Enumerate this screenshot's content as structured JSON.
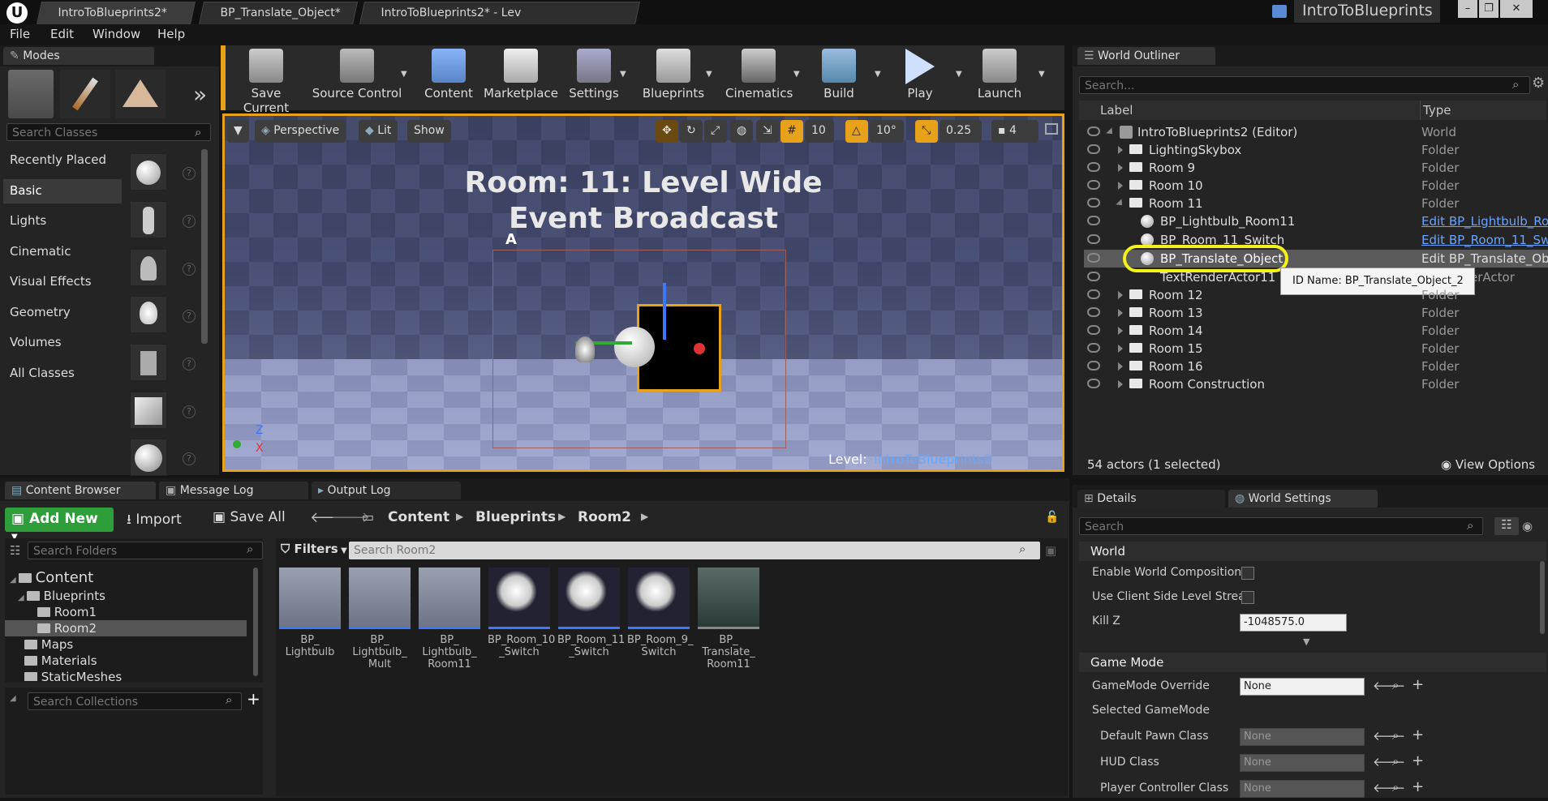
{
  "app": {
    "logo": "U"
  },
  "tabs": [
    "IntroToBlueprints2*",
    "BP_Translate_Object*",
    "IntroToBlueprints2* - Lev"
  ],
  "project_name": "IntroToBlueprints",
  "menu": [
    "File",
    "Edit",
    "Window",
    "Help"
  ],
  "modes": {
    "tab": "Modes",
    "search_placeholder": "Search Classes",
    "categories": [
      "Recently Placed",
      "Basic",
      "Lights",
      "Cinematic",
      "Visual Effects",
      "Geometry",
      "Volumes",
      "All Classes"
    ],
    "selected": "Basic"
  },
  "toolbar": {
    "save_current": "Save Current",
    "source_control": "Source Control",
    "content": "Content",
    "marketplace": "Marketplace",
    "settings": "Settings",
    "blueprints": "Blueprints",
    "cinematics": "Cinematics",
    "build": "Build",
    "play": "Play",
    "launch": "Launch"
  },
  "viewport": {
    "perspective": "Perspective",
    "lit": "Lit",
    "show": "Show",
    "grid_snap": "10",
    "rot_snap": "10°",
    "scale_snap": "0.25",
    "cam_speed": "4",
    "room_title_line1": "Room: 11: Level Wide",
    "room_title_line2": "Event Broadcast",
    "marker_a": "A",
    "axis_z": "Z",
    "axis_x": "X",
    "level_label": "Level:",
    "level_name": "IntroToBlueprints2 (Persistent)"
  },
  "outliner": {
    "tab": "World Outliner",
    "search_placeholder": "Search...",
    "col_label": "Label",
    "col_type": "Type",
    "rows": [
      {
        "label": "IntroToBlueprints2 (Editor)",
        "type": "World"
      },
      {
        "label": "LightingSkybox",
        "type": "Folder"
      },
      {
        "label": "Room 9",
        "type": "Folder"
      },
      {
        "label": "Room 10",
        "type": "Folder"
      },
      {
        "label": "Room 11",
        "type": "Folder"
      },
      {
        "label": "BP_Lightbulb_Room11",
        "type": "Edit BP_Lightbulb_Roo"
      },
      {
        "label": "BP_Room_11_Switch",
        "type": "Edit BP_Room_11_Sw"
      },
      {
        "label": "BP_Translate_Object",
        "type": "Edit BP_Translate_Ob"
      },
      {
        "label": "TextRenderActor11",
        "type": "erActor"
      },
      {
        "label": "Room 12",
        "type": "Folder"
      },
      {
        "label": "Room 13",
        "type": "Folder"
      },
      {
        "label": "Room 14",
        "type": "Folder"
      },
      {
        "label": "Room 15",
        "type": "Folder"
      },
      {
        "label": "Room 16",
        "type": "Folder"
      },
      {
        "label": "Room Construction",
        "type": "Folder"
      }
    ],
    "tooltip": "ID Name: BP_Translate_Object_2",
    "actor_count": "54 actors (1 selected)",
    "view_options": "View Options"
  },
  "details": {
    "tab_details": "Details",
    "tab_world_settings": "World Settings",
    "search_placeholder": "Search",
    "section_world": "World",
    "enable_world_composition": "Enable World Composition",
    "use_client_side": "Use Client Side Level Strea",
    "kill_z_label": "Kill Z",
    "kill_z_value": "-1048575.0",
    "section_game_mode": "Game Mode",
    "gamemode_override": "GameMode Override",
    "gamemode_override_value": "None",
    "selected_gamemode": "Selected GameMode",
    "default_pawn": "Default Pawn Class",
    "hud_class": "HUD Class",
    "player_controller": "Player Controller Class",
    "none": "None"
  },
  "content_browser": {
    "tab": "Content Browser",
    "tab_message_log": "Message Log",
    "tab_output_log": "Output Log",
    "add_new": "Add New",
    "import": "Import",
    "save_all": "Save All",
    "breadcrumb": [
      "Content",
      "Blueprints",
      "Room2"
    ],
    "search_folders": "Search Folders",
    "filters": "Filters",
    "search_assets": "Search Room2",
    "search_collections": "Search Collections",
    "tree": [
      "Content",
      "Blueprints",
      "Room1",
      "Room2",
      "Maps",
      "Materials",
      "StaticMeshes"
    ],
    "assets": [
      {
        "l1": "BP_",
        "l2": "Lightbulb",
        "l3": ""
      },
      {
        "l1": "BP_",
        "l2": "Lightbulb_",
        "l3": "Mult"
      },
      {
        "l1": "BP_",
        "l2": "Lightbulb_",
        "l3": "Room11"
      },
      {
        "l1": "BP_Room_10",
        "l2": "_Switch",
        "l3": ""
      },
      {
        "l1": "BP_Room_11",
        "l2": "_Switch",
        "l3": ""
      },
      {
        "l1": "BP_Room_9_",
        "l2": "Switch",
        "l3": ""
      },
      {
        "l1": "BP_",
        "l2": "Translate_",
        "l3": "Room11"
      }
    ]
  },
  "colors": {
    "accent_orange": "#e8a21a",
    "selection_yellow": "#f2f21a",
    "link_blue": "#6aa3ff",
    "add_green": "#2e9e3a"
  }
}
